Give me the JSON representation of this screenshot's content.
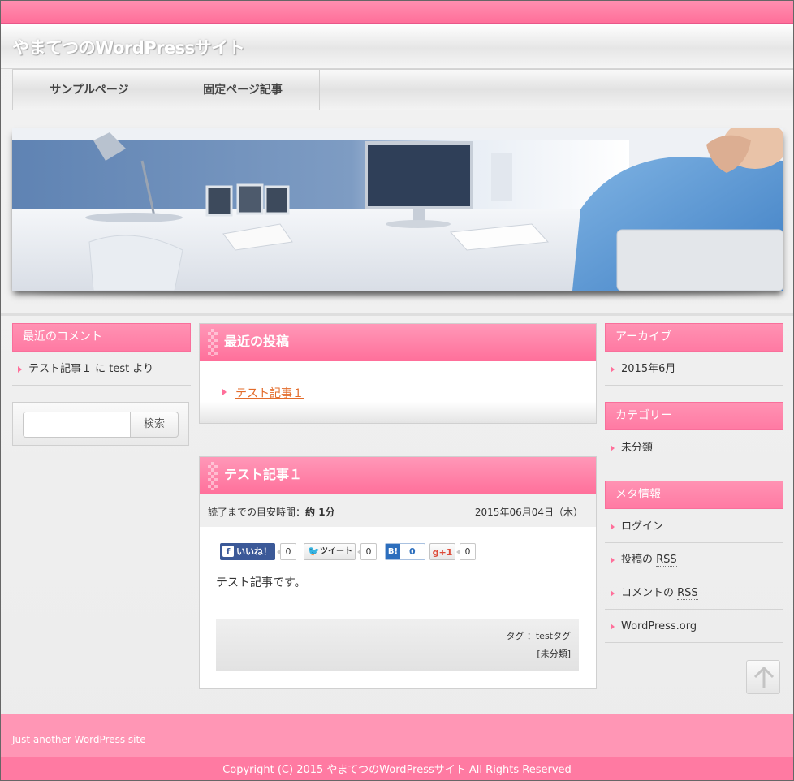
{
  "site": {
    "title": "やまてつのWordPressサイト",
    "tagline": "Just another WordPress site",
    "copyright": "Copyright (C) 2015 やまてつのWordPressサイト  All Rights Reserved"
  },
  "nav": {
    "items": [
      {
        "label": "サンプルページ"
      },
      {
        "label": "固定ページ記事"
      }
    ]
  },
  "left_sidebar": {
    "recent_comments": {
      "title": "最近のコメント",
      "items": [
        {
          "post": "テスト記事１",
          "connector": " に ",
          "author": "test",
          "suffix": " より"
        }
      ]
    },
    "search": {
      "button_label": "検索",
      "placeholder": "",
      "value": ""
    }
  },
  "recent_posts": {
    "title": "最近の投稿",
    "items": [
      {
        "label": "テスト記事１"
      }
    ]
  },
  "post": {
    "title": "テスト記事１",
    "reading_time_label": "読了までの目安時間：",
    "reading_time_value": "約 1分",
    "date": "2015年06月04日（木）",
    "share": {
      "facebook_label": "いいね！",
      "facebook_count": "0",
      "twitter_label": "ツイート",
      "twitter_count": "0",
      "hatena_label": "B!",
      "hatena_count": "0",
      "google_label": "g+1",
      "google_count": "0"
    },
    "body": "テスト記事です。",
    "tag_line": "タグ ：testタグ",
    "category_line": "[未分類]"
  },
  "right_sidebar": {
    "archives": {
      "title": "アーカイブ",
      "items": [
        {
          "label": "2015年6月"
        }
      ]
    },
    "categories": {
      "title": "カテゴリー",
      "items": [
        {
          "label": "未分類"
        }
      ]
    },
    "meta": {
      "title": "メタ情報",
      "items": [
        {
          "label": "ログイン"
        },
        {
          "prefix": "投稿の ",
          "abbr": "RSS"
        },
        {
          "prefix": "コメントの ",
          "abbr": "RSS"
        },
        {
          "label": "WordPress.org"
        }
      ]
    }
  },
  "colors": {
    "accent_pink": "#ff7aa3",
    "link_orange": "#e36c2b",
    "facebook_blue": "#3b5998",
    "twitter_blue": "#55acee",
    "hatena_blue": "#2c6ebd",
    "google_red": "#dd4b39"
  },
  "icons": {
    "back_to_top": "arrow-up-icon",
    "list_bullet": "pink-triangle-icon"
  }
}
